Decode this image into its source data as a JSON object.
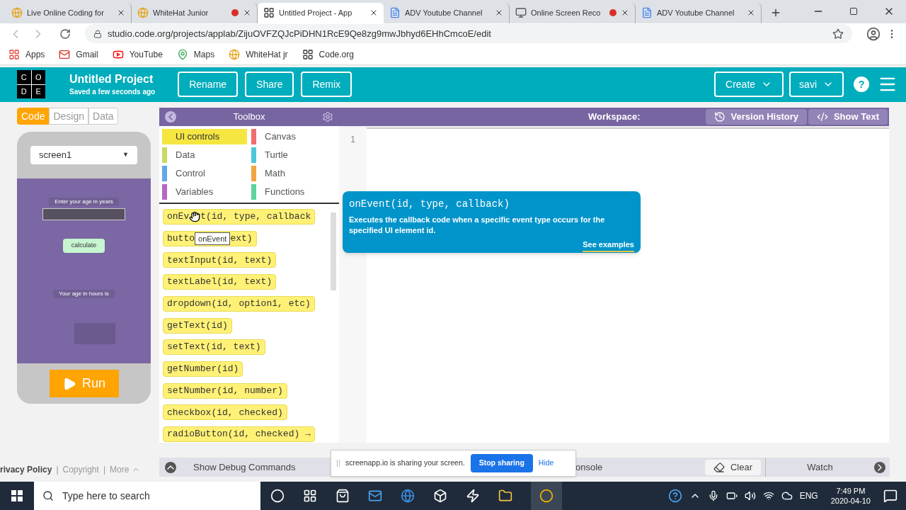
{
  "browser": {
    "tabs": [
      {
        "title": "Live Online Coding for",
        "selected": false,
        "recording": false
      },
      {
        "title": "WhiteHat Junior",
        "selected": false,
        "recording": true
      },
      {
        "title": "Untitled Project - App",
        "selected": true,
        "recording": false
      },
      {
        "title": "ADV Youtube Channel",
        "selected": false,
        "recording": false
      },
      {
        "title": "Online Screen Reco",
        "selected": false,
        "recording": true
      },
      {
        "title": "ADV Youtube Channel",
        "selected": false,
        "recording": false
      }
    ],
    "url": "studio.code.org/projects/applab/ZijuOVFZQJcPiDHN1RcE9Qe8zg9mwJbhyd6EHhCmcoE/edit",
    "bookmarks": [
      {
        "label": "Apps",
        "kind": "apps"
      },
      {
        "label": "Gmail",
        "kind": "gmail"
      },
      {
        "label": "YouTube",
        "kind": "youtube"
      },
      {
        "label": "Maps",
        "kind": "maps"
      },
      {
        "label": "WhiteHat jr",
        "kind": "whitehat"
      },
      {
        "label": "Code.org",
        "kind": "codeorg"
      }
    ]
  },
  "header": {
    "logo": [
      "C",
      "O",
      "D",
      "E"
    ],
    "title": "Untitled Project",
    "subtitle": "Saved a few seconds ago",
    "buttons": [
      "Rename",
      "Share",
      "Remix"
    ],
    "create": "Create",
    "user": "savi",
    "help": "?"
  },
  "mode_tabs": [
    {
      "label": "Code",
      "selected": true
    },
    {
      "label": "Design",
      "selected": false
    },
    {
      "label": "Data",
      "selected": false
    }
  ],
  "screen_select": {
    "value": "screen1",
    "caret": "▼"
  },
  "app_preview": {
    "prompt": "Enter your age in years",
    "button": "calculate",
    "result_label": "Your age in hours is"
  },
  "run_button": "Run",
  "toolbox": {
    "title": "Toolbox",
    "categories": [
      {
        "label": "UI controls",
        "color": "#f5e642",
        "selected": true
      },
      {
        "label": "Canvas",
        "color": "#f06e6e",
        "selected": false
      },
      {
        "label": "Data",
        "color": "#c4dd60",
        "selected": false
      },
      {
        "label": "Turtle",
        "color": "#4dc7d9",
        "selected": false
      },
      {
        "label": "Control",
        "color": "#64a6e8",
        "selected": false
      },
      {
        "label": "Math",
        "color": "#f2a540",
        "selected": false
      },
      {
        "label": "Variables",
        "color": "#b668c4",
        "selected": false
      },
      {
        "label": "Functions",
        "color": "#5dd39e",
        "selected": false
      }
    ],
    "blocks": [
      {
        "text": "onEv",
        "cursor": true,
        "text_after": "t(id, type, callback"
      },
      {
        "text": "butto",
        "tooltip": "onEvent",
        "text_after": "ext)"
      },
      {
        "text": "textInput(id, text)"
      },
      {
        "text": "textLabel(id, text)"
      },
      {
        "text": "dropdown(id, option1, etc)"
      },
      {
        "text": "getText(id)"
      },
      {
        "text": "setText(id, text)"
      },
      {
        "text": "getNumber(id)"
      },
      {
        "text": "setNumber(id, number)"
      },
      {
        "text": "checkbox(id, checked)"
      },
      {
        "text": "radioButton(id, checked) →"
      }
    ]
  },
  "workspace": {
    "title": "Workspace:",
    "buttons": [
      {
        "label": "Version History",
        "kind": "history"
      },
      {
        "label": "Show Text",
        "kind": "code"
      }
    ],
    "line_numbers": [
      "1"
    ],
    "doc_popup": {
      "signature": "onEvent(id, type, callback)",
      "description": "Executes the callback code when a specific event type occurs for the specified UI element id.",
      "link": "See examples"
    }
  },
  "debug_bar": {
    "toggle": "Show Debug Commands",
    "console": "onsole",
    "clear": "Clear",
    "watch": "Watch"
  },
  "footer_links": [
    "rivacy Policy",
    "Copyright",
    "More"
  ],
  "footer_separator": "|",
  "share_notice": {
    "text": "screenapp.io is sharing your screen.",
    "stop": "Stop sharing",
    "hide": "Hide"
  },
  "taskbar": {
    "search_placeholder": "Type here to search",
    "language": "ENG",
    "time": "7:49 PM",
    "date": "2020-04-10"
  }
}
